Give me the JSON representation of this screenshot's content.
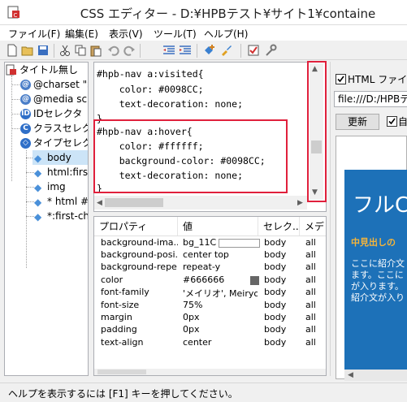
{
  "window": {
    "title": "CSS エディター - D:¥HPBテスト¥サイト1¥containe"
  },
  "menu": [
    "ファイル(F)",
    "編集(E)",
    "表示(V)",
    "ツール(T)",
    "ヘルプ(H)"
  ],
  "toolbar": {
    "buttons": [
      "new-file-icon",
      "open-folder-icon",
      "save-icon",
      "cut-icon",
      "copy-icon",
      "paste-icon",
      "undo-icon",
      "redo-icon",
      "outdent-icon",
      "indent-icon",
      "add-selector-icon",
      "brush-icon",
      "checkbox-icon",
      "wrench-icon"
    ]
  },
  "tree": {
    "root": "タイトル無し",
    "items": [
      "@charset \"S",
      "@media scr",
      "IDセレクタ",
      "クラスセレクタ",
      "タイプセレクタ"
    ],
    "type_children": [
      "body",
      "html:firs",
      "img",
      "* html #",
      "*:first-ch"
    ]
  },
  "code": {
    "lines": [
      "#hpb-nav a:visited{",
      "    color: #0098CC;",
      "    text-decoration: none;",
      "}",
      "#hpb-nav a:hover{",
      "    color: #ffffff;",
      "    background-color: #0098CC;",
      "    text-decoration: none;",
      "}"
    ]
  },
  "properties": {
    "headers": [
      "プロパティ",
      "値",
      "セレク...",
      "メデ"
    ],
    "rows": [
      {
        "prop": "background-ima...",
        "value": "bg_11C",
        "sel": "body",
        "media": "all",
        "swatch": ""
      },
      {
        "prop": "background-posi...",
        "value": "center top",
        "sel": "body",
        "media": "all",
        "swatch": ""
      },
      {
        "prop": "background-repe...",
        "value": "repeat-y",
        "sel": "body",
        "media": "all",
        "swatch": ""
      },
      {
        "prop": "color",
        "value": "#666666",
        "sel": "body",
        "media": "all",
        "swatch": "#666666"
      },
      {
        "prop": "font-family",
        "value": "'メイリオ', Meiryo...",
        "sel": "body",
        "media": "all",
        "swatch": ""
      },
      {
        "prop": "font-size",
        "value": "75%",
        "sel": "body",
        "media": "all",
        "swatch": ""
      },
      {
        "prop": "margin",
        "value": "0px",
        "sel": "body",
        "media": "all",
        "swatch": ""
      },
      {
        "prop": "padding",
        "value": "0px",
        "sel": "body",
        "media": "all",
        "swatch": ""
      },
      {
        "prop": "text-align",
        "value": "center",
        "sel": "body",
        "media": "all",
        "swatch": ""
      }
    ]
  },
  "preview": {
    "checkbox_label": "HTML ファイル",
    "url": "file:///D:/HPBテ",
    "refresh_label": "更新",
    "auto_checkbox_label": "自",
    "site_big": "フルC",
    "site_heading": "中見出しの",
    "site_text": [
      "ここに紹介文",
      "ます。ここに",
      "が入ります。",
      "紹介文が入り"
    ]
  },
  "status": {
    "text": "ヘルプを表示するには [F1] キーを押してください。"
  },
  "colors": {
    "highlight": "#e0203c",
    "site_blue": "#1d71b8",
    "site_accent": "#f6b53a"
  }
}
